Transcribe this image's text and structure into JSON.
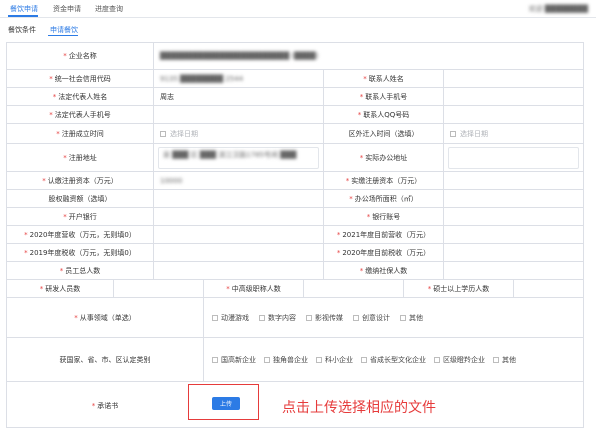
{
  "top_tabs": [
    {
      "label": "餐饮申请"
    },
    {
      "label": "资金申请"
    },
    {
      "label": "进度查询"
    }
  ],
  "user_label": "欢迎 ████████",
  "sub": {
    "section_label": "餐饮条件",
    "tab_label": "申请餐饮"
  },
  "form": {
    "company_name": "企业名称",
    "credit_code": "统一社会信用代码",
    "credit_code_value": "9135 ████████ 2544",
    "contact_name": "联系人姓名",
    "legal_name": "法定代表人姓名",
    "legal_name_value": "周志",
    "contact_phone": "联系人手机号",
    "legal_phone": "法定代表人手机号",
    "contact_qq": "联系人QQ号码",
    "register_date": "注册成立时间",
    "date_placeholder": "选择日期",
    "move_date": "区外迁入时间（选填）",
    "register_addr": "注册地址",
    "register_addr_value": "泉 ███ 区 ███ 滨江汉路1785号闲 ███",
    "office_addr": "实际办公地址",
    "subscribed_capital": "认缴注册资本（万元）",
    "subscribed_value": "10000",
    "paid_capital": "实缴注册资本（万元）",
    "equity_fin": "股权融资额（选填）",
    "office_area": "办公场所面积（㎡）",
    "bank": "开户银行",
    "bank_account": "银行账号",
    "rev2020": "2020年度营收（万元，无则填0）",
    "rev2021": "2021年度目前营收（万元）",
    "tax2019": "2019年度税收（万元，无则填0）",
    "tax2020": "2020年度目前税收（万元）",
    "staff": "员工总人数",
    "insured": "缴纳社保人数",
    "rd_staff": "研发人员数",
    "mid_title": "中高级职称人数",
    "master": "硕士以上学历人数",
    "industry": "从事领域（单选）",
    "industry_options": [
      "动漫游戏",
      "数字内容",
      "影视传媒",
      "创意设计",
      "其他"
    ],
    "recog": "获国家、省、市、区认定类别",
    "recog_options": [
      "国高新企业",
      "独角兽企业",
      "科小企业",
      "省成长型文化企业",
      "区级瞪羚企业",
      "其他"
    ],
    "promise": "承诺书",
    "upload_label": "上传"
  },
  "hint_text": "点击上传选择相应的文件",
  "colors": {
    "accent": "#2c7be5",
    "required": "#e64242",
    "annotation": "#e63b3b"
  }
}
